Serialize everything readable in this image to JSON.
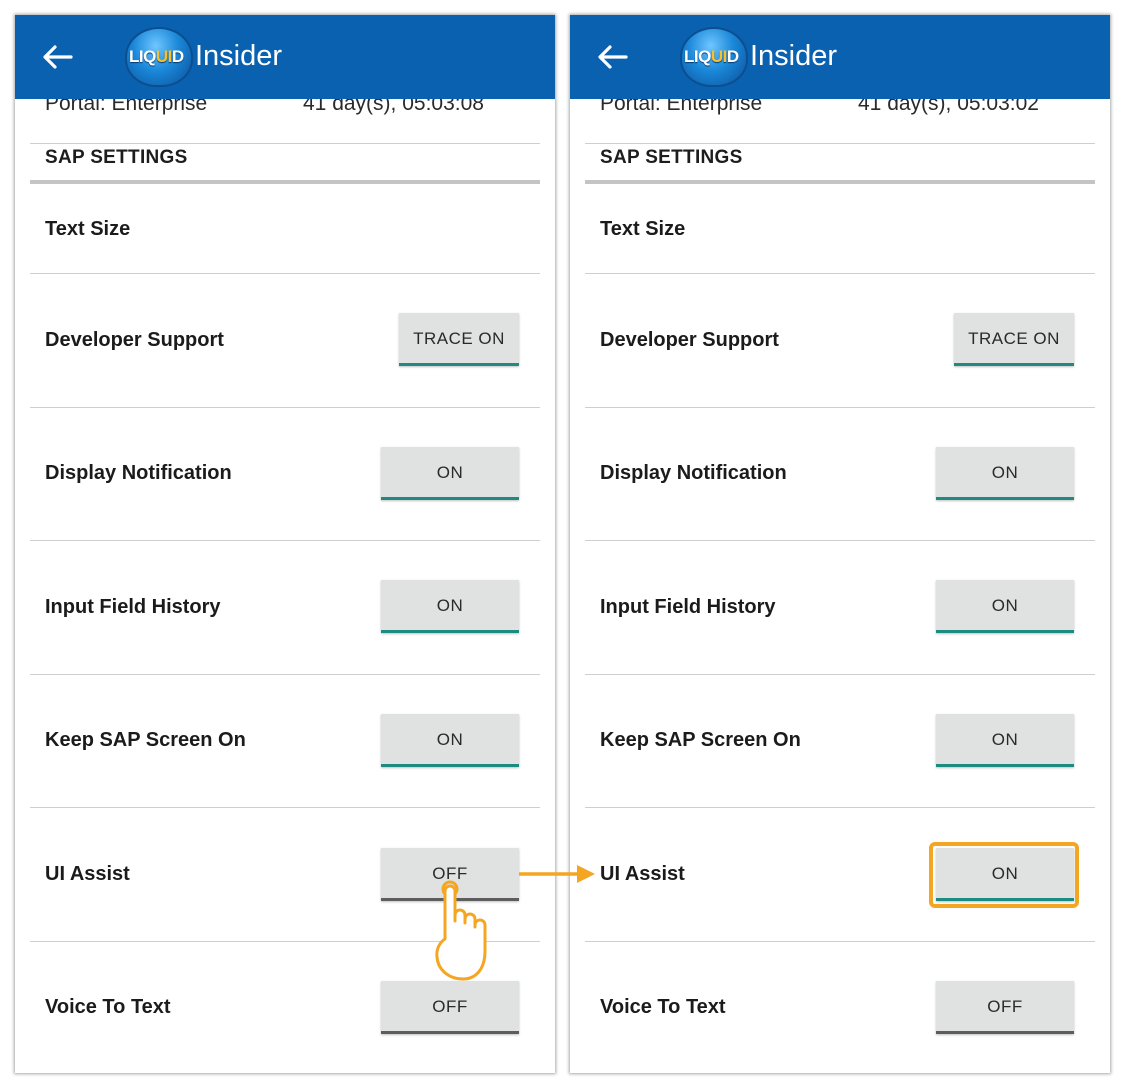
{
  "app": {
    "logo_liquid": "LIQ",
    "logo_ui": "UI",
    "logo_d": "D",
    "logo_insider": "Insider"
  },
  "icons": {
    "back": "back-arrow-icon",
    "tap": "tap-hand-icon",
    "transition": "arrow-right-icon"
  },
  "colors": {
    "appbar": "#0961b0",
    "toggle_on_underline": "#1d8b7f",
    "toggle_off_underline": "#5d5d5d",
    "highlight": "#f4a623"
  },
  "screens": [
    {
      "portal_label": "Portal: Enterprise",
      "portal_value": "41 day(s), 05:03:08",
      "section_title": "SAP SETTINGS",
      "text_size_label": "Text Size",
      "settings": [
        {
          "label": "Developer Support",
          "value": "TRACE ON"
        },
        {
          "label": "Display Notification",
          "value": "ON"
        },
        {
          "label": "Input Field History",
          "value": "ON"
        },
        {
          "label": "Keep SAP Screen On",
          "value": "ON"
        },
        {
          "label": "UI Assist",
          "value": "OFF"
        },
        {
          "label": "Voice To Text",
          "value": "OFF"
        }
      ]
    },
    {
      "portal_label": "Portal: Enterprise",
      "portal_value": "41 day(s), 05:03:02",
      "section_title": "SAP SETTINGS",
      "text_size_label": "Text Size",
      "settings": [
        {
          "label": "Developer Support",
          "value": "TRACE ON"
        },
        {
          "label": "Display Notification",
          "value": "ON"
        },
        {
          "label": "Input Field History",
          "value": "ON"
        },
        {
          "label": "Keep SAP Screen On",
          "value": "ON"
        },
        {
          "label": "UI Assist",
          "value": "ON"
        },
        {
          "label": "Voice To Text",
          "value": "OFF"
        }
      ]
    }
  ]
}
